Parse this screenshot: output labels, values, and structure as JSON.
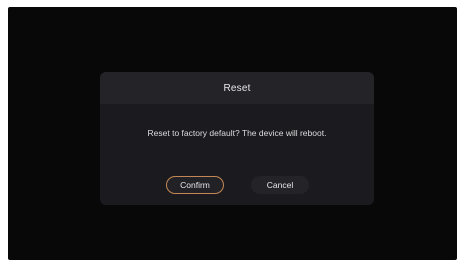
{
  "dialog": {
    "title": "Reset",
    "message": "Reset to factory default? The device will reboot.",
    "confirm_label": "Confirm",
    "cancel_label": "Cancel"
  },
  "colors": {
    "background": "#080809",
    "dialog_body": "#1b1b1f",
    "dialog_header": "#232328",
    "focus_accent": "#c28754"
  }
}
